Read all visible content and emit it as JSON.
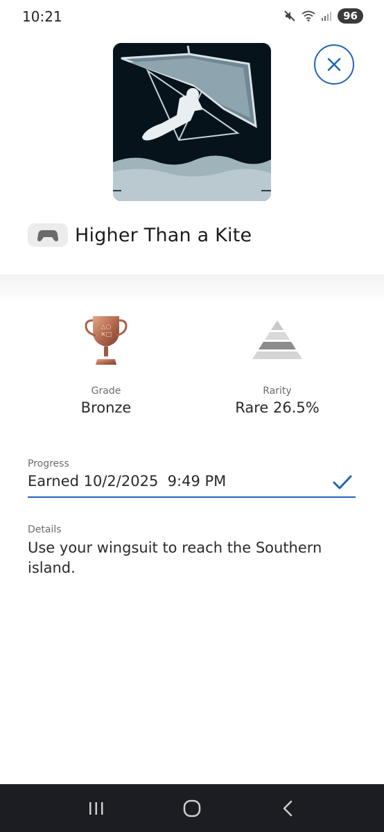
{
  "status_bar": {
    "time": "10:21",
    "battery": "96",
    "icons": [
      "mute-icon",
      "wifi-icon",
      "signal-icon",
      "battery-icon"
    ]
  },
  "header": {
    "image_icon": "hang-glider-trophy-art",
    "close_icon": "close-icon",
    "platform_icon": "gamepad-icon",
    "title": "Higher Than a Kite"
  },
  "stats": {
    "grade": {
      "icon": "bronze-trophy-icon",
      "label": "Grade",
      "value": "Bronze",
      "color": "#b36a4e"
    },
    "rarity": {
      "icon": "rarity-pyramid-icon",
      "label": "Rarity",
      "value": "Rare 26.5%"
    }
  },
  "progress": {
    "label": "Progress",
    "value": "Earned 10/2/2025  9:49 PM",
    "status_icon": "checkmark-icon"
  },
  "details": {
    "label": "Details",
    "text": "Use your wingsuit to reach the Southern island."
  },
  "nav": {
    "recents_icon": "recents-icon",
    "home_icon": "home-icon",
    "back_icon": "back-icon"
  },
  "colors": {
    "accent": "#1f63b5",
    "text": "#2a2a2a",
    "label": "#6b6b6b",
    "nav_bar": "#1b1d22",
    "image_bg": "#07131b"
  }
}
